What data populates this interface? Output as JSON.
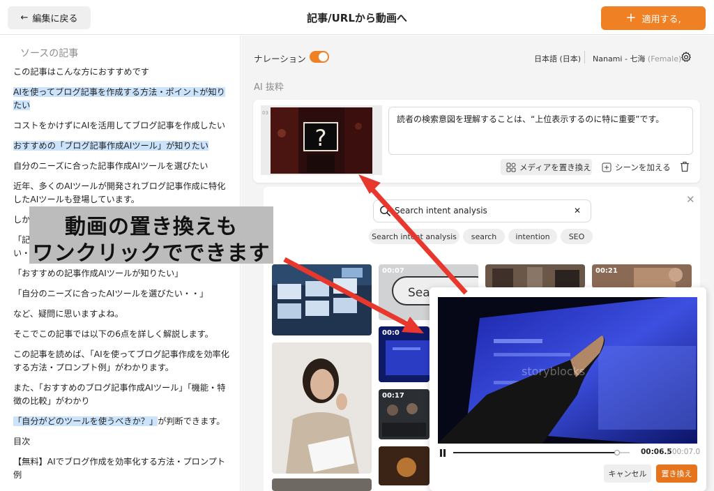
{
  "header": {
    "back_label": "編集に戻る",
    "title": "記事/URLから動画へ",
    "apply_label": "適用する,"
  },
  "source": {
    "title": "ソースの記事",
    "paragraphs": [
      "この記事はこんな方におすすめです",
      "AIを使ってブログ記事を作成する方法・ポイントが知りたい",
      "コストをかけずにAIを活用してブログ記事を作成したい",
      "おすすめの「ブログ記事作成AIツール」が知りたい",
      "自分のニーズに合った記事作成AIツールを選びたい",
      "近年、多くのAIツールが開発されブログ記事作成に特化したAIツールも登場しています。",
      "しか",
      "「記",
      "い・",
      "「おすすめの記事作成AIツールが知りたい」",
      "「自分のニーズに合ったAIツールを選びたい・・」",
      "など、疑問に思いますよね。",
      "そこでこの記事では以下の6点を詳しく解説します。",
      "この記事を読めば、「AIを使ってブログ記事作成を効率化する方法・プロンプト例」がわかります。",
      "また、「おすすめのブログ記事作成AIツール」「機能・特徴の比較」がわかり",
      "「自分がどのツールを使うべきか？」",
      "が判断できます。",
      "目次",
      "【無料】AIでブログ作成を効率化する方法・プロンプト例"
    ]
  },
  "narration": {
    "label": "ナレーション",
    "enabled": true,
    "language": "日本語 (日本)",
    "voice": "Nanami - 七海",
    "gender": "(Female)"
  },
  "ai_section": {
    "label": "AI 抜粋",
    "scene_number": "03",
    "scene_text": "読者の検索意図を理解することは、“上位表示するのに特に重要”です。",
    "replace_media_label": "メディアを置き換え",
    "add_scene_label": "シーンを加える"
  },
  "search": {
    "value": "Search intent analysis",
    "chips": [
      "Search intent analysis",
      "search",
      "intention",
      "SEO"
    ]
  },
  "results": {
    "durations": [
      "00:07",
      "00:21",
      "00:0",
      "00:17"
    ]
  },
  "annotation": {
    "line1": "動画の置き換えも",
    "line2": "ワンクリックでできます"
  },
  "preview": {
    "current_time": "00:06.5",
    "total_time": "/ 00:07.0",
    "progress": 0.93,
    "cancel_label": "キャンセル",
    "replace_label": "置き換え",
    "watermark": "storyblocks"
  },
  "colors": {
    "accent": "#f08024",
    "highlight": "#cbe4fb",
    "arrow": "#e8372c"
  }
}
